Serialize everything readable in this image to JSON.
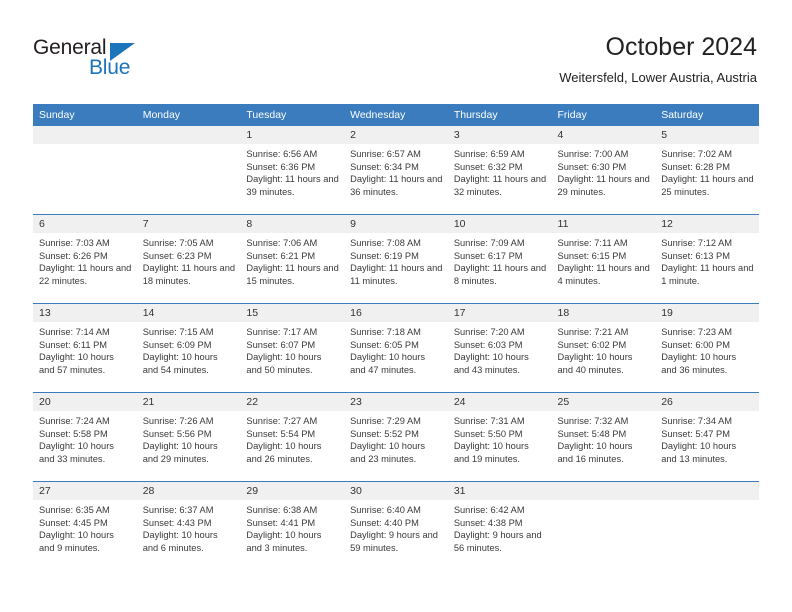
{
  "brand": {
    "name_part1": "General",
    "name_part2": "Blue",
    "logo_icon": "triangle-icon"
  },
  "header": {
    "title": "October 2024",
    "location": "Weitersfeld, Lower Austria, Austria"
  },
  "colors": {
    "header_blue": "#3a7cbe",
    "brand_blue": "#1b75bb",
    "daynum_band": "#f0f0f0",
    "text": "#222222"
  },
  "weekday_headers": [
    "Sunday",
    "Monday",
    "Tuesday",
    "Wednesday",
    "Thursday",
    "Friday",
    "Saturday"
  ],
  "labels": {
    "sunrise_prefix": "Sunrise:",
    "sunset_prefix": "Sunset:",
    "daylight_prefix": "Daylight:"
  },
  "weeks": [
    [
      {
        "day": "",
        "sunrise": "",
        "sunset": "",
        "daylight": "",
        "blank": true
      },
      {
        "day": "",
        "sunrise": "",
        "sunset": "",
        "daylight": "",
        "blank": true
      },
      {
        "day": "1",
        "sunrise": "Sunrise: 6:56 AM",
        "sunset": "Sunset: 6:36 PM",
        "daylight": "Daylight: 11 hours and 39 minutes."
      },
      {
        "day": "2",
        "sunrise": "Sunrise: 6:57 AM",
        "sunset": "Sunset: 6:34 PM",
        "daylight": "Daylight: 11 hours and 36 minutes."
      },
      {
        "day": "3",
        "sunrise": "Sunrise: 6:59 AM",
        "sunset": "Sunset: 6:32 PM",
        "daylight": "Daylight: 11 hours and 32 minutes."
      },
      {
        "day": "4",
        "sunrise": "Sunrise: 7:00 AM",
        "sunset": "Sunset: 6:30 PM",
        "daylight": "Daylight: 11 hours and 29 minutes."
      },
      {
        "day": "5",
        "sunrise": "Sunrise: 7:02 AM",
        "sunset": "Sunset: 6:28 PM",
        "daylight": "Daylight: 11 hours and 25 minutes."
      }
    ],
    [
      {
        "day": "6",
        "sunrise": "Sunrise: 7:03 AM",
        "sunset": "Sunset: 6:26 PM",
        "daylight": "Daylight: 11 hours and 22 minutes."
      },
      {
        "day": "7",
        "sunrise": "Sunrise: 7:05 AM",
        "sunset": "Sunset: 6:23 PM",
        "daylight": "Daylight: 11 hours and 18 minutes."
      },
      {
        "day": "8",
        "sunrise": "Sunrise: 7:06 AM",
        "sunset": "Sunset: 6:21 PM",
        "daylight": "Daylight: 11 hours and 15 minutes."
      },
      {
        "day": "9",
        "sunrise": "Sunrise: 7:08 AM",
        "sunset": "Sunset: 6:19 PM",
        "daylight": "Daylight: 11 hours and 11 minutes."
      },
      {
        "day": "10",
        "sunrise": "Sunrise: 7:09 AM",
        "sunset": "Sunset: 6:17 PM",
        "daylight": "Daylight: 11 hours and 8 minutes."
      },
      {
        "day": "11",
        "sunrise": "Sunrise: 7:11 AM",
        "sunset": "Sunset: 6:15 PM",
        "daylight": "Daylight: 11 hours and 4 minutes."
      },
      {
        "day": "12",
        "sunrise": "Sunrise: 7:12 AM",
        "sunset": "Sunset: 6:13 PM",
        "daylight": "Daylight: 11 hours and 1 minute."
      }
    ],
    [
      {
        "day": "13",
        "sunrise": "Sunrise: 7:14 AM",
        "sunset": "Sunset: 6:11 PM",
        "daylight": "Daylight: 10 hours and 57 minutes."
      },
      {
        "day": "14",
        "sunrise": "Sunrise: 7:15 AM",
        "sunset": "Sunset: 6:09 PM",
        "daylight": "Daylight: 10 hours and 54 minutes."
      },
      {
        "day": "15",
        "sunrise": "Sunrise: 7:17 AM",
        "sunset": "Sunset: 6:07 PM",
        "daylight": "Daylight: 10 hours and 50 minutes."
      },
      {
        "day": "16",
        "sunrise": "Sunrise: 7:18 AM",
        "sunset": "Sunset: 6:05 PM",
        "daylight": "Daylight: 10 hours and 47 minutes."
      },
      {
        "day": "17",
        "sunrise": "Sunrise: 7:20 AM",
        "sunset": "Sunset: 6:03 PM",
        "daylight": "Daylight: 10 hours and 43 minutes."
      },
      {
        "day": "18",
        "sunrise": "Sunrise: 7:21 AM",
        "sunset": "Sunset: 6:02 PM",
        "daylight": "Daylight: 10 hours and 40 minutes."
      },
      {
        "day": "19",
        "sunrise": "Sunrise: 7:23 AM",
        "sunset": "Sunset: 6:00 PM",
        "daylight": "Daylight: 10 hours and 36 minutes."
      }
    ],
    [
      {
        "day": "20",
        "sunrise": "Sunrise: 7:24 AM",
        "sunset": "Sunset: 5:58 PM",
        "daylight": "Daylight: 10 hours and 33 minutes."
      },
      {
        "day": "21",
        "sunrise": "Sunrise: 7:26 AM",
        "sunset": "Sunset: 5:56 PM",
        "daylight": "Daylight: 10 hours and 29 minutes."
      },
      {
        "day": "22",
        "sunrise": "Sunrise: 7:27 AM",
        "sunset": "Sunset: 5:54 PM",
        "daylight": "Daylight: 10 hours and 26 minutes."
      },
      {
        "day": "23",
        "sunrise": "Sunrise: 7:29 AM",
        "sunset": "Sunset: 5:52 PM",
        "daylight": "Daylight: 10 hours and 23 minutes."
      },
      {
        "day": "24",
        "sunrise": "Sunrise: 7:31 AM",
        "sunset": "Sunset: 5:50 PM",
        "daylight": "Daylight: 10 hours and 19 minutes."
      },
      {
        "day": "25",
        "sunrise": "Sunrise: 7:32 AM",
        "sunset": "Sunset: 5:48 PM",
        "daylight": "Daylight: 10 hours and 16 minutes."
      },
      {
        "day": "26",
        "sunrise": "Sunrise: 7:34 AM",
        "sunset": "Sunset: 5:47 PM",
        "daylight": "Daylight: 10 hours and 13 minutes."
      }
    ],
    [
      {
        "day": "27",
        "sunrise": "Sunrise: 6:35 AM",
        "sunset": "Sunset: 4:45 PM",
        "daylight": "Daylight: 10 hours and 9 minutes."
      },
      {
        "day": "28",
        "sunrise": "Sunrise: 6:37 AM",
        "sunset": "Sunset: 4:43 PM",
        "daylight": "Daylight: 10 hours and 6 minutes."
      },
      {
        "day": "29",
        "sunrise": "Sunrise: 6:38 AM",
        "sunset": "Sunset: 4:41 PM",
        "daylight": "Daylight: 10 hours and 3 minutes."
      },
      {
        "day": "30",
        "sunrise": "Sunrise: 6:40 AM",
        "sunset": "Sunset: 4:40 PM",
        "daylight": "Daylight: 9 hours and 59 minutes."
      },
      {
        "day": "31",
        "sunrise": "Sunrise: 6:42 AM",
        "sunset": "Sunset: 4:38 PM",
        "daylight": "Daylight: 9 hours and 56 minutes."
      },
      {
        "day": "",
        "sunrise": "",
        "sunset": "",
        "daylight": "",
        "blank": true
      },
      {
        "day": "",
        "sunrise": "",
        "sunset": "",
        "daylight": "",
        "blank": true
      }
    ]
  ]
}
